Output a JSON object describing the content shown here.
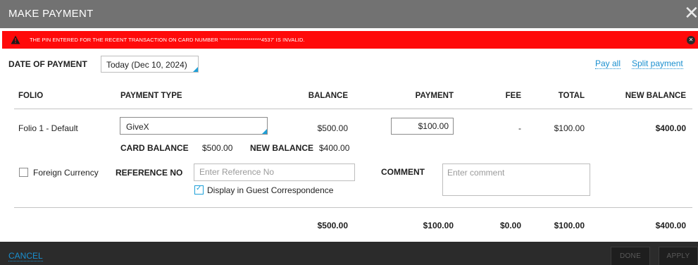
{
  "dialog": {
    "title": "MAKE PAYMENT",
    "close_glyph": "✕"
  },
  "alert": {
    "message": "THE PIN ENTERED FOR THE RECENT TRANSACTION ON CARD NUMBER '*******************4537' IS INVALID.",
    "dismiss_glyph": "✕",
    "background_color": "#ff0a0a"
  },
  "date": {
    "label": "DATE OF PAYMENT",
    "value": "Today (Dec 10, 2024)"
  },
  "links": {
    "pay_all": "Pay all",
    "split_payment": "Split payment"
  },
  "table": {
    "headers": {
      "folio": "FOLIO",
      "payment_type": "PAYMENT TYPE",
      "balance": "BALANCE",
      "payment": "PAYMENT",
      "fee": "FEE",
      "total": "TOTAL",
      "new_balance": "NEW BALANCE"
    },
    "row": {
      "folio": "Folio 1 - Default",
      "payment_type": "GiveX",
      "balance": "$500.00",
      "payment": "$100.00",
      "fee": "-",
      "total": "$100.00",
      "new_balance": "$400.00"
    },
    "card": {
      "card_balance_label": "CARD BALANCE",
      "card_balance_value": "$500.00",
      "new_balance_label": "NEW BALANCE",
      "new_balance_value": "$400.00"
    },
    "totals": {
      "balance": "$500.00",
      "payment": "$100.00",
      "fee": "$0.00",
      "total": "$100.00",
      "new_balance": "$400.00"
    }
  },
  "options": {
    "foreign_currency_label": "Foreign Currency",
    "reference_label": "REFERENCE NO",
    "reference_placeholder": "Enter Reference No",
    "display_guest_label": "Display in Guest Correspondence",
    "comment_label": "COMMENT",
    "comment_placeholder": "Enter comment"
  },
  "footer": {
    "cancel": "CANCEL",
    "done": "DONE",
    "apply": "APPLY"
  },
  "colors": {
    "accent": "#1a8fcf",
    "titlebar": "#727272",
    "footer": "#2b2b2b"
  }
}
